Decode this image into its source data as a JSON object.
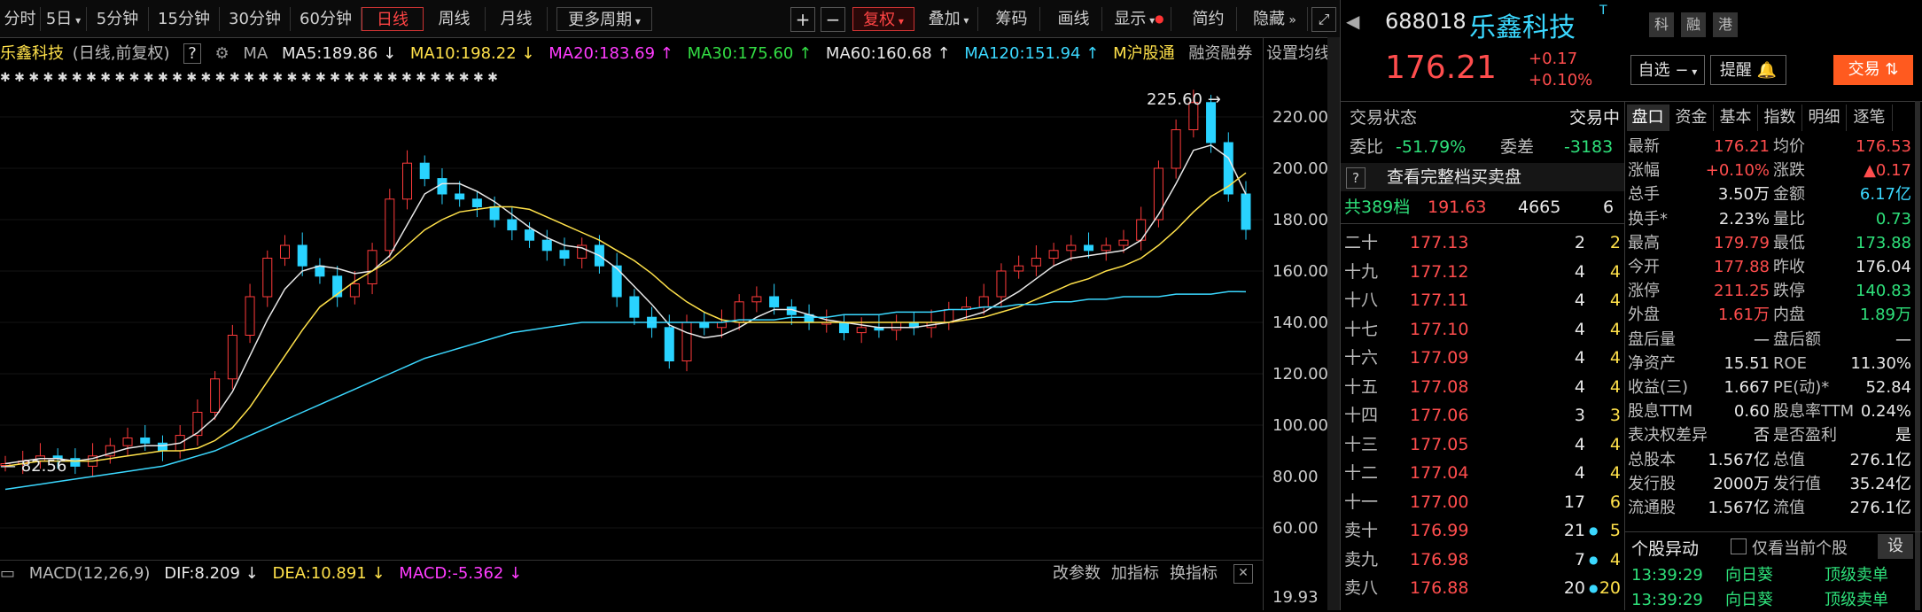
{
  "toolbar": {
    "periods": [
      "分时",
      "5日",
      "5分钟",
      "15分钟",
      "30分钟",
      "60分钟",
      "日线",
      "周线",
      "月线",
      "更多周期"
    ],
    "active_period": "日线",
    "plus": "+",
    "minus": "−",
    "fuquan": "复权",
    "tools": [
      "叠加",
      "筹码",
      "画线",
      "显示",
      "简约",
      "隐藏"
    ],
    "expand_icon": "expand-icon"
  },
  "ma_line": {
    "name": "乐鑫科技",
    "mode": "(日线,前复权)",
    "help": "?",
    "ma_label": "MA",
    "items": [
      {
        "text": "MA5:189.86 ↓",
        "color": "#e8e8e8"
      },
      {
        "text": "MA10:198.22 ↓",
        "color": "#ffe14a"
      },
      {
        "text": "MA20:183.69 ↑",
        "color": "#ff3cff"
      },
      {
        "text": "MA30:175.60 ↑",
        "color": "#33dd44"
      },
      {
        "text": "MA60:160.68 ↑",
        "color": "#e8e8e8"
      },
      {
        "text": "MA120:151.94 ↑",
        "color": "#3bd8ff"
      },
      {
        "text": "M沪股通",
        "color": "#ffe14a"
      }
    ],
    "links": [
      "融资融券",
      "设置均线"
    ]
  },
  "chart": {
    "y_ticks": [
      "220.00",
      "200.00",
      "180.00",
      "160.00",
      "140.00",
      "120.00",
      "100.00",
      "80.00",
      "60.00"
    ],
    "max_label": "225.60",
    "min_label": "82.56",
    "macd_value_label": "19.93"
  },
  "chart_data": {
    "type": "line",
    "title": "",
    "ylim": [
      60,
      225.6
    ],
    "series": [
      {
        "name": "K线",
        "values": [
          85,
          86,
          88,
          87,
          84,
          88,
          92,
          95,
          93,
          90,
          96,
          105,
          118,
          135,
          150,
          165,
          170,
          162,
          158,
          150,
          155,
          168,
          188,
          202,
          196,
          190,
          188,
          185,
          180,
          176,
          172,
          168,
          165,
          170,
          162,
          150,
          142,
          138,
          125,
          140,
          138,
          140,
          148,
          150,
          146,
          143,
          140,
          140,
          136,
          138,
          137,
          140,
          138,
          140,
          145,
          146,
          150,
          160,
          162,
          165,
          168,
          170,
          168,
          170,
          172,
          180,
          200,
          215,
          225.6,
          210,
          190,
          176.21
        ]
      },
      {
        "name": "MA5",
        "values": [
          85,
          86,
          87,
          87,
          86,
          87,
          89,
          91,
          92,
          92,
          93,
          97,
          103,
          113,
          127,
          141,
          153,
          160,
          162,
          161,
          159,
          160,
          166,
          178,
          190,
          194,
          194,
          191,
          187,
          182,
          177,
          173,
          170,
          169,
          166,
          161,
          154,
          147,
          139,
          136,
          134,
          135,
          138,
          142,
          145,
          145,
          143,
          141,
          140,
          139,
          138,
          138,
          138,
          139,
          140,
          142,
          144,
          148,
          152,
          157,
          162,
          165,
          166,
          167,
          168,
          172,
          182,
          194,
          207,
          209,
          204,
          189.86
        ]
      },
      {
        "name": "MA10",
        "values": [
          84,
          85,
          86,
          86,
          86,
          86,
          87,
          88,
          89,
          90,
          90,
          91,
          94,
          99,
          107,
          117,
          127,
          137,
          146,
          151,
          156,
          160,
          164,
          170,
          176,
          180,
          183,
          184,
          185,
          185,
          184,
          181,
          178,
          175,
          172,
          168,
          164,
          159,
          153,
          148,
          144,
          141,
          140,
          140,
          140,
          140,
          140,
          140,
          140,
          140,
          140,
          140,
          140,
          140,
          140,
          141,
          142,
          144,
          146,
          149,
          152,
          155,
          157,
          160,
          162,
          165,
          170,
          176,
          183,
          189,
          193,
          198.22
        ]
      },
      {
        "name": "MA120",
        "values": [
          75,
          76,
          77,
          78,
          79,
          80,
          81,
          82,
          83,
          84,
          86,
          88,
          90,
          93,
          96,
          99,
          102,
          105,
          108,
          111,
          114,
          117,
          120,
          123,
          126,
          128,
          130,
          132,
          134,
          136,
          137,
          138,
          139,
          140,
          140,
          140,
          140,
          140,
          140,
          140,
          140,
          140,
          141,
          141,
          141,
          142,
          142,
          142,
          143,
          143,
          143,
          144,
          144,
          144,
          145,
          145,
          146,
          146,
          147,
          147,
          148,
          148,
          149,
          149,
          150,
          150,
          150,
          151,
          151,
          151,
          152,
          151.94
        ]
      }
    ]
  },
  "macd": {
    "label": "MACD(12,26,9)",
    "dif": "DIF:8.209 ↓",
    "dea": "DEA:10.891 ↓",
    "macd": "MACD:-5.362 ↓",
    "links": [
      "改参数",
      "加指标",
      "换指标"
    ]
  },
  "quote": {
    "code": "688018",
    "name": "乐鑫科技",
    "t_mark": "T",
    "badges": [
      "科",
      "融",
      "港"
    ],
    "price": "176.21",
    "change": "+0.17",
    "change_pct": "+0.10%",
    "btn_watch": "自选 −",
    "btn_alert": "提醒",
    "btn_trade": "交易"
  },
  "orderbook": {
    "status_label": "交易状态",
    "status_value": "交易中",
    "weibi_label": "委比",
    "weibi_value": "-51.79%",
    "weicha_label": "委差",
    "weicha_value": "-3183",
    "full_label": "查看完整档买卖盘",
    "total_label": "共389档",
    "total_price": "191.63",
    "total_vol": "4665",
    "total_cnt": "6",
    "rows": [
      {
        "lvl": "二十",
        "price": "177.13",
        "vol": "2",
        "cnt": "2",
        "dot": false
      },
      {
        "lvl": "十九",
        "price": "177.12",
        "vol": "4",
        "cnt": "4",
        "dot": false
      },
      {
        "lvl": "十八",
        "price": "177.11",
        "vol": "4",
        "cnt": "4",
        "dot": false
      },
      {
        "lvl": "十七",
        "price": "177.10",
        "vol": "4",
        "cnt": "4",
        "dot": false
      },
      {
        "lvl": "十六",
        "price": "177.09",
        "vol": "4",
        "cnt": "4",
        "dot": false
      },
      {
        "lvl": "十五",
        "price": "177.08",
        "vol": "4",
        "cnt": "4",
        "dot": false
      },
      {
        "lvl": "十四",
        "price": "177.06",
        "vol": "3",
        "cnt": "3",
        "dot": false
      },
      {
        "lvl": "十三",
        "price": "177.05",
        "vol": "4",
        "cnt": "4",
        "dot": false
      },
      {
        "lvl": "十二",
        "price": "177.04",
        "vol": "4",
        "cnt": "4",
        "dot": false
      },
      {
        "lvl": "十一",
        "price": "177.00",
        "vol": "17",
        "cnt": "6",
        "dot": false
      },
      {
        "lvl": "卖十",
        "price": "176.99",
        "vol": "21",
        "cnt": "5",
        "dot": true
      },
      {
        "lvl": "卖九",
        "price": "176.98",
        "vol": "7",
        "cnt": "4",
        "dot": true
      },
      {
        "lvl": "卖八",
        "price": "176.88",
        "vol": "20",
        "cnt": "20",
        "dot": true
      }
    ]
  },
  "tabs": [
    "盘口",
    "资金",
    "基本",
    "指数",
    "明细",
    "逐笔"
  ],
  "stats": [
    {
      "l1": "最新",
      "v1": "176.21",
      "c1": "red",
      "l2": "均价",
      "v2": "176.53",
      "c2": "red"
    },
    {
      "l1": "涨幅",
      "v1": "+0.10%",
      "c1": "red",
      "l2": "涨跌",
      "v2": "▲0.17",
      "c2": "red"
    },
    {
      "l1": "总手",
      "v1": "3.50万",
      "c1": "white",
      "l2": "金额",
      "v2": "6.17亿",
      "c2": "cyan"
    },
    {
      "l1": "换手*",
      "v1": "2.23%",
      "c1": "white",
      "l2": "量比",
      "v2": "0.73",
      "c2": "green"
    },
    {
      "l1": "最高",
      "v1": "179.79",
      "c1": "red",
      "l2": "最低",
      "v2": "173.88",
      "c2": "green"
    },
    {
      "l1": "今开",
      "v1": "177.88",
      "c1": "red",
      "l2": "昨收",
      "v2": "176.04",
      "c2": "white"
    },
    {
      "l1": "涨停",
      "v1": "211.25",
      "c1": "red",
      "l2": "跌停",
      "v2": "140.83",
      "c2": "green"
    },
    {
      "l1": "外盘",
      "v1": "1.61万",
      "c1": "red",
      "l2": "内盘",
      "v2": "1.89万",
      "c2": "green"
    },
    {
      "l1": "盘后量",
      "v1": "—",
      "c1": "white",
      "l2": "盘后额",
      "v2": "—",
      "c2": "white"
    },
    {
      "l1": "净资产",
      "v1": "15.51",
      "c1": "white",
      "l2": "ROE",
      "v2": "11.30%",
      "c2": "white"
    },
    {
      "l1": "收益(三)",
      "v1": "1.667",
      "c1": "white",
      "l2": "PE(动)*",
      "v2": "52.84",
      "c2": "white"
    },
    {
      "l1": "股息TTM",
      "v1": "0.60",
      "c1": "white",
      "l2": "股息率TTM",
      "v2": "0.24%",
      "c2": "white"
    },
    {
      "l1": "表决权差异",
      "v1": "否",
      "c1": "white",
      "l2": "是否盈利",
      "v2": "是",
      "c2": "white"
    },
    {
      "l1": "总股本",
      "v1": "1.567亿",
      "c1": "white",
      "l2": "总值",
      "v2": "276.1亿",
      "c2": "white"
    },
    {
      "l1": "发行股",
      "v1": "2000万",
      "c1": "white",
      "l2": "发行值",
      "v2": "35.24亿",
      "c2": "white"
    },
    {
      "l1": "流通股",
      "v1": "1.567亿",
      "c1": "white",
      "l2": "流值",
      "v2": "276.1亿",
      "c2": "white"
    }
  ],
  "movers": {
    "title": "个股异动",
    "checkbox_label": "仅看当前个股",
    "settings": "设",
    "rows": [
      {
        "time": "13:39:29",
        "who": "向日葵",
        "what": "顶级卖单"
      },
      {
        "time": "13:39:29",
        "who": "向日葵",
        "what": "顶级卖单"
      }
    ]
  }
}
